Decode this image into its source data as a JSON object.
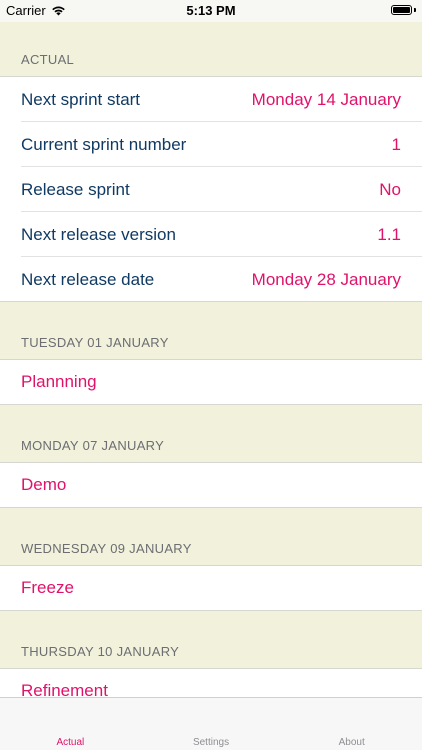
{
  "status_bar": {
    "carrier": "Carrier",
    "time": "5:13 PM"
  },
  "actual_section": {
    "header": "ACTUAL",
    "rows": [
      {
        "label": "Next sprint start",
        "value": "Monday 14 January"
      },
      {
        "label": "Current sprint number",
        "value": "1"
      },
      {
        "label": "Release sprint",
        "value": "No"
      },
      {
        "label": "Next release version",
        "value": "1.1"
      },
      {
        "label": "Next release date",
        "value": "Monday 28 January"
      }
    ]
  },
  "events": [
    {
      "date": "TUESDAY 01 JANUARY",
      "title": "Plannning"
    },
    {
      "date": "MONDAY 07 JANUARY",
      "title": "Demo"
    },
    {
      "date": "WEDNESDAY 09 JANUARY",
      "title": "Freeze"
    },
    {
      "date": "THURSDAY 10 JANUARY",
      "title": "Refinement"
    }
  ],
  "tab_bar": {
    "tabs": [
      "Actual",
      "Settings",
      "About"
    ],
    "active": "Actual"
  },
  "colors": {
    "accent": "#e0126b",
    "label": "#103a63",
    "background": "#f1f1dc"
  }
}
